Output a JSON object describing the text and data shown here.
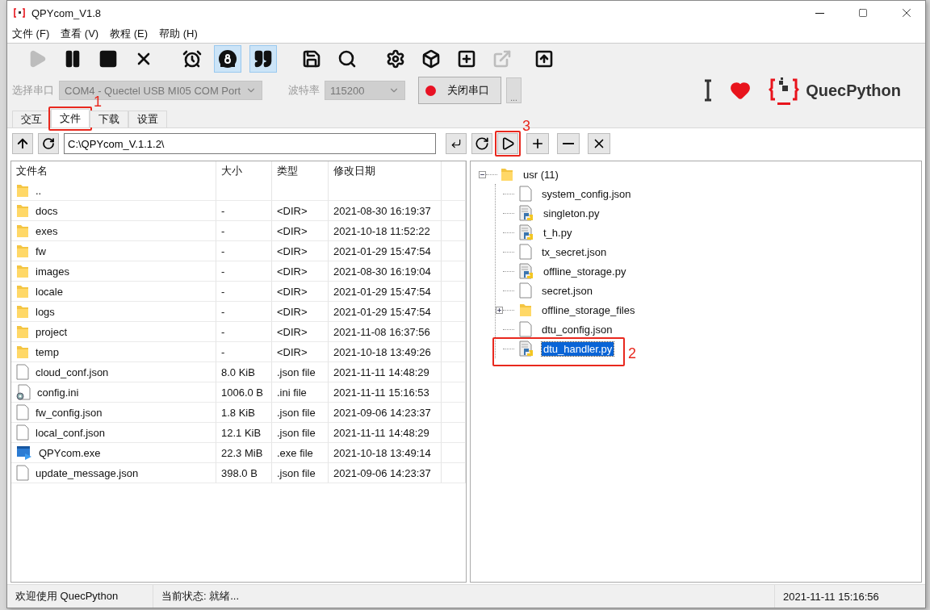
{
  "window": {
    "title": "QPYcom_V1.8"
  },
  "menu": [
    "文件 (F)",
    "查看 (V)",
    "教程 (E)",
    "帮助 (H)"
  ],
  "toolbar": [
    {
      "selected": false,
      "disabled": true
    },
    {
      "selected": false,
      "disabled": false
    },
    {
      "selected": false,
      "disabled": false
    },
    {
      "selected": false,
      "disabled": false
    },
    {
      "selected": false,
      "disabled": false
    },
    {
      "selected": true,
      "disabled": false
    },
    {
      "selected": true,
      "disabled": false
    },
    {
      "selected": false,
      "disabled": false
    },
    {
      "selected": false,
      "disabled": false
    },
    {
      "selected": false,
      "disabled": false
    },
    {
      "selected": false,
      "disabled": false
    },
    {
      "selected": false,
      "disabled": false
    },
    {
      "selected": false,
      "disabled": true
    },
    {
      "selected": false,
      "disabled": false
    }
  ],
  "port": {
    "label": "选择串口",
    "value": "COM4 - Quectel USB MI05 COM Port",
    "baud_label": "波特率",
    "baud": "115200",
    "button": "关闭串口",
    "more": "...",
    "disabled": true
  },
  "brand": "QuecPython",
  "tabs": [
    {
      "label": "交互",
      "selected": false
    },
    {
      "label": "文件",
      "selected": true,
      "callout": "1"
    },
    {
      "label": "下载",
      "selected": false
    },
    {
      "label": "设置",
      "selected": false
    }
  ],
  "path": "C:\\QPYcom_V.1.1.2\\",
  "table": {
    "columns": [
      "文件名",
      "大小",
      "类型",
      "修改日期"
    ],
    "rows": [
      {
        "kind": "folder",
        "name": "..",
        "size": "",
        "type": "",
        "date": ""
      },
      {
        "kind": "folder",
        "name": "docs",
        "size": "-",
        "type": "<DIR>",
        "date": "2021-08-30 16:19:37"
      },
      {
        "kind": "folder",
        "name": "exes",
        "size": "-",
        "type": "<DIR>",
        "date": "2021-10-18 11:52:22"
      },
      {
        "kind": "folder",
        "name": "fw",
        "size": "-",
        "type": "<DIR>",
        "date": "2021-01-29 15:47:54"
      },
      {
        "kind": "folder",
        "name": "images",
        "size": "-",
        "type": "<DIR>",
        "date": "2021-08-30 16:19:04"
      },
      {
        "kind": "folder",
        "name": "locale",
        "size": "-",
        "type": "<DIR>",
        "date": "2021-01-29 15:47:54"
      },
      {
        "kind": "folder",
        "name": "logs",
        "size": "-",
        "type": "<DIR>",
        "date": "2021-01-29 15:47:54"
      },
      {
        "kind": "folder",
        "name": "project",
        "size": "-",
        "type": "<DIR>",
        "date": "2021-11-08 16:37:56"
      },
      {
        "kind": "folder",
        "name": "temp",
        "size": "-",
        "type": "<DIR>",
        "date": "2021-10-18 13:49:26"
      },
      {
        "kind": "file",
        "name": "cloud_conf.json",
        "size": "8.0 KiB",
        "type": ".json file",
        "date": "2021-11-11 14:48:29"
      },
      {
        "kind": "config",
        "name": "config.ini",
        "size": "1006.0 B",
        "type": ".ini file",
        "date": "2021-11-11 15:16:53"
      },
      {
        "kind": "file",
        "name": "fw_config.json",
        "size": "1.8 KiB",
        "type": ".json file",
        "date": "2021-09-06 14:23:37"
      },
      {
        "kind": "file",
        "name": "local_conf.json",
        "size": "12.1 KiB",
        "type": ".json file",
        "date": "2021-11-11 14:48:29"
      },
      {
        "kind": "exe",
        "name": "QPYcom.exe",
        "size": "22.3 MiB",
        "type": ".exe file",
        "date": "2021-10-18 13:49:14"
      },
      {
        "kind": "file",
        "name": "update_message.json",
        "size": "398.0 B",
        "type": ".json file",
        "date": "2021-09-06 14:23:37"
      }
    ]
  },
  "run_callout": "3",
  "tree": [
    {
      "kind": "folder",
      "name": "usr (11)",
      "expanded": true,
      "selected": false,
      "children": [
        {
          "kind": "file",
          "name": "system_config.json",
          "selected": false
        },
        {
          "kind": "python",
          "name": "singleton.py",
          "selected": false
        },
        {
          "kind": "python",
          "name": "t_h.py",
          "selected": false
        },
        {
          "kind": "file",
          "name": "tx_secret.json",
          "selected": false
        },
        {
          "kind": "python",
          "name": "offline_storage.py",
          "selected": false
        },
        {
          "kind": "file",
          "name": "secret.json",
          "selected": false
        },
        {
          "kind": "folder",
          "name": "offline_storage_files",
          "expanded": false,
          "selected": false
        },
        {
          "kind": "file",
          "name": "dtu_config.json",
          "selected": false
        },
        {
          "kind": "python",
          "name": "dtu_handler.py",
          "selected": true,
          "callout": "2"
        }
      ]
    }
  ],
  "status_bar": [
    "欢迎使用 QuecPython",
    "当前状态: 就绪...",
    "2021-11-11 15:16:56"
  ]
}
